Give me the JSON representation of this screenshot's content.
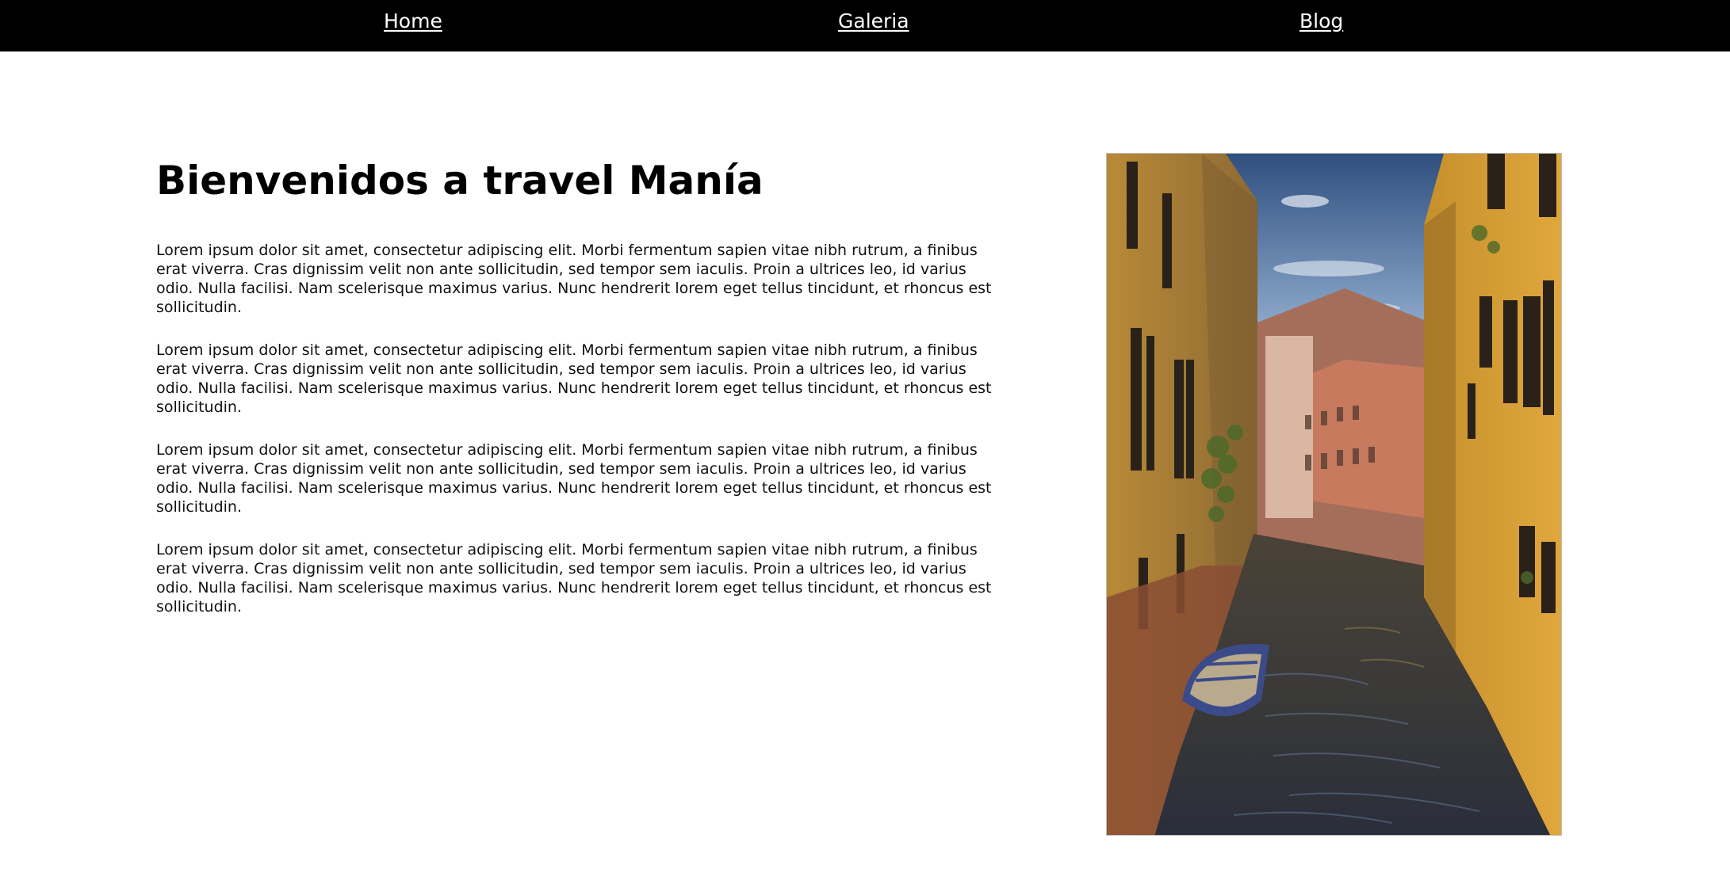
{
  "nav": {
    "home": "Home",
    "galeria": "Galeria",
    "blog": "Blog"
  },
  "main": {
    "title": "Bienvenidos a travel Manía",
    "paragraphs": [
      "Lorem ipsum dolor sit amet, consectetur adipiscing elit. Morbi fermentum sapien vitae nibh rutrum, a finibus erat viverra. Cras dignissim velit non ante sollicitudin, sed tempor sem iaculis. Proin a ultrices leo, id varius odio. Nulla facilisi. Nam scelerisque maximus varius. Nunc hendrerit lorem eget tellus tincidunt, et rhoncus est sollicitudin.",
      "Lorem ipsum dolor sit amet, consectetur adipiscing elit. Morbi fermentum sapien vitae nibh rutrum, a finibus erat viverra. Cras dignissim velit non ante sollicitudin, sed tempor sem iaculis. Proin a ultrices leo, id varius odio. Nulla facilisi. Nam scelerisque maximus varius. Nunc hendrerit lorem eget tellus tincidunt, et rhoncus est sollicitudin.",
      "Lorem ipsum dolor sit amet, consectetur adipiscing elit. Morbi fermentum sapien vitae nibh rutrum, a finibus erat viverra. Cras dignissim velit non ante sollicitudin, sed tempor sem iaculis. Proin a ultrices leo, id varius odio. Nulla facilisi. Nam scelerisque maximus varius. Nunc hendrerit lorem eget tellus tincidunt, et rhoncus est sollicitudin.",
      "Lorem ipsum dolor sit amet, consectetur adipiscing elit. Morbi fermentum sapien vitae nibh rutrum, a finibus erat viverra. Cras dignissim velit non ante sollicitudin, sed tempor sem iaculis. Proin a ultrices leo, id varius odio. Nulla facilisi. Nam scelerisque maximus varius. Nunc hendrerit lorem eget tellus tincidunt, et rhoncus est sollicitudin."
    ]
  },
  "colors": {
    "navbar_bg": "#000000",
    "nav_link": "#ffffff",
    "page_bg": "#ffffff",
    "text": "#111111"
  }
}
